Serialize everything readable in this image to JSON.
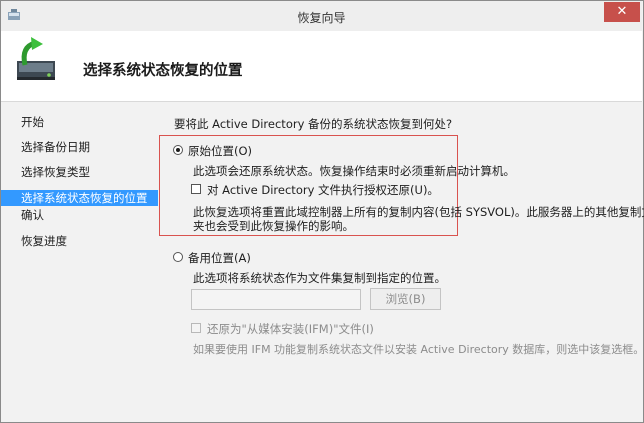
{
  "window": {
    "title": "恢复向导",
    "close_glyph": "✕"
  },
  "header": {
    "title": "选择系统状态恢复的位置",
    "icon": "restore-wizard-icon"
  },
  "sidebar": {
    "items": [
      {
        "label": "开始"
      },
      {
        "label": "选择备份日期"
      },
      {
        "label": "选择恢复类型"
      },
      {
        "label": "选择系统状态恢复的位置",
        "active": true
      },
      {
        "label": "确认"
      },
      {
        "label": "恢复进度"
      }
    ]
  },
  "main": {
    "question": "要将此 Active Directory 备份的系统状态恢复到何处?",
    "original": {
      "label": "原始位置(O)",
      "selected": true,
      "desc": "此选项会还原系统状态。恢复操作结束时必须重新启动计算机。",
      "authoritative_label": "对 Active Directory 文件执行授权还原(U)。",
      "authoritative_checked": false,
      "warning_line1": "此恢复选项将重置此域控制器上所有的复制内容(包括 SYSVOL)。此服务器上的其他复制文件",
      "warning_line2": "夹也会受到此恢复操作的影响。"
    },
    "alternate": {
      "label": "备用位置(A)",
      "selected": false,
      "desc": "此选项将系统状态作为文件集复制到指定的位置。",
      "path_value": "",
      "browse_label": "浏览(B)",
      "ifm_label": "还原为\"从媒体安装(IFM)\"文件(I)",
      "ifm_checked": false,
      "ifm_note": "如果要使用 IFM 功能复制系统状态文件以安装 Active Directory 数据库，则选中该复选框。"
    }
  },
  "colors": {
    "accent": "#3399ff",
    "highlight_border": "#d9534f",
    "close": "#c7504b"
  }
}
